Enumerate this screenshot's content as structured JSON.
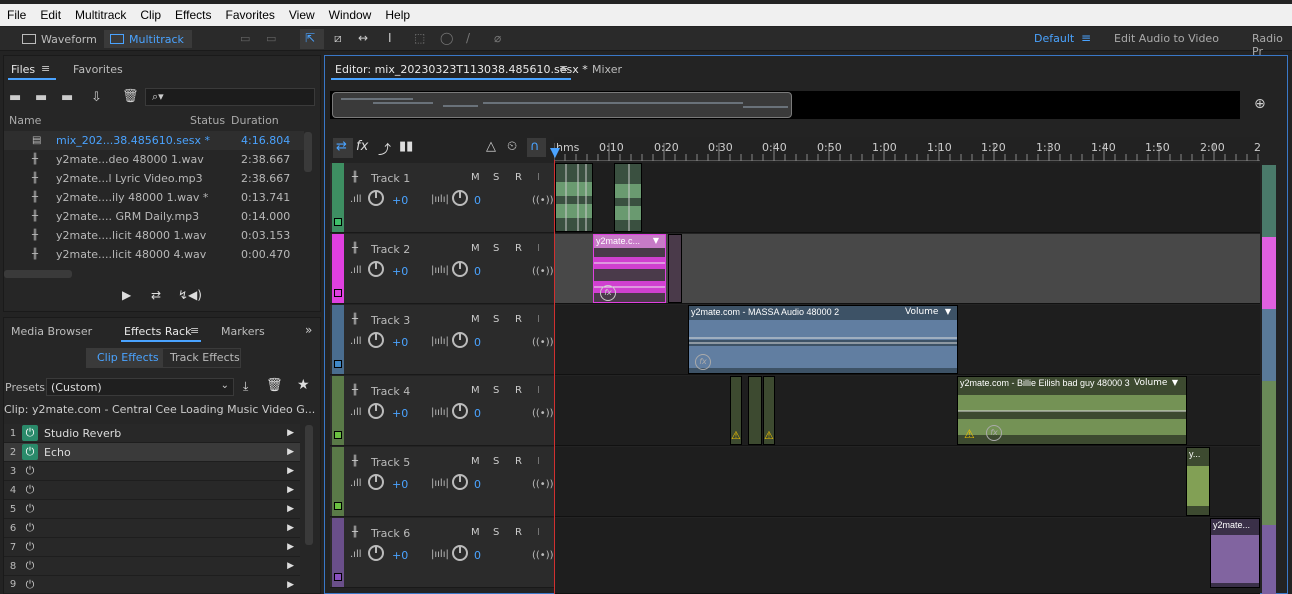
{
  "menu": [
    "File",
    "Edit",
    "Multitrack",
    "Clip",
    "Effects",
    "Favorites",
    "View",
    "Window",
    "Help"
  ],
  "toolbar": {
    "waveform_label": "Waveform",
    "multitrack_label": "Multitrack",
    "workspace_default": "Default",
    "edit_audio_to_video": "Edit Audio to Video",
    "radio": "Radio Pr"
  },
  "files_panel": {
    "tab_files": "Files",
    "tab_favorites": "Favorites",
    "col_name": "Name",
    "col_status": "Status",
    "col_duration": "Duration",
    "rows": [
      {
        "name": "mix_202...38.485610.sesx *",
        "duration": "4:16.804"
      },
      {
        "name": "y2mate...deo 48000 1.wav",
        "duration": "2:38.667"
      },
      {
        "name": "y2mate...l Lyric Video.mp3",
        "duration": "2:38.667"
      },
      {
        "name": "y2mate....ily 48000 1.wav *",
        "duration": "0:13.741"
      },
      {
        "name": "y2mate.... GRM Daily.mp3",
        "duration": "0:14.000"
      },
      {
        "name": "y2mate....licit 48000 1.wav",
        "duration": "0:03.153"
      },
      {
        "name": "y2mate....licit 48000 4.wav",
        "duration": "0:00.470"
      }
    ]
  },
  "effects_panel": {
    "tab_media": "Media Browser",
    "tab_effects": "Effects Rack",
    "tab_markers": "Markers",
    "sub_clip": "Clip Effects",
    "sub_track": "Track Effects",
    "presets_label": "Presets:",
    "presets_value": "(Custom)",
    "clip_label": "Clip: y2mate.com - Central Cee  Loading Music Video  G...",
    "slots": [
      {
        "num": "1",
        "name": "Studio Reverb"
      },
      {
        "num": "2",
        "name": "Echo"
      },
      {
        "num": "3",
        "name": ""
      },
      {
        "num": "4",
        "name": ""
      },
      {
        "num": "5",
        "name": ""
      },
      {
        "num": "6",
        "name": ""
      },
      {
        "num": "7",
        "name": ""
      },
      {
        "num": "8",
        "name": ""
      },
      {
        "num": "9",
        "name": ""
      }
    ]
  },
  "editor": {
    "tab_editor": "Editor: mix_20230323T113038.485610.sesx *",
    "tab_mixer": "Mixer",
    "ruler": [
      "hms",
      "0:10",
      "0:20",
      "0:30",
      "0:40",
      "0:50",
      "1:00",
      "1:10",
      "1:20",
      "1:30",
      "1:40",
      "1:50",
      "2:00",
      "2"
    ],
    "tracks": [
      {
        "name": "Track 1",
        "vol": "+0",
        "pan": "0",
        "color": "#3e8f62"
      },
      {
        "name": "Track 2",
        "vol": "+0",
        "pan": "0",
        "color": "#e040e0"
      },
      {
        "name": "Track 3",
        "vol": "+0",
        "pan": "0",
        "color": "#3f88c8"
      },
      {
        "name": "Track 4",
        "vol": "+0",
        "pan": "0",
        "color": "#6ac040"
      },
      {
        "name": "Track 5",
        "vol": "+0",
        "pan": "0",
        "color": "#6ac040"
      },
      {
        "name": "Track 6",
        "vol": "+0",
        "pan": "0",
        "color": "#8a50c0"
      }
    ],
    "msr": [
      "M",
      "S",
      "R",
      "I"
    ],
    "clips": {
      "t2": "y2mate.c...",
      "t3": "y2mate.com - MASSA Audio 48000 2",
      "t3_vol": "Volume",
      "t4": "y2mate.com - Billie Eilish  bad guy 48000 3",
      "t4_vol": "Volume",
      "t5": "y...",
      "t6": "y2mate..."
    }
  }
}
